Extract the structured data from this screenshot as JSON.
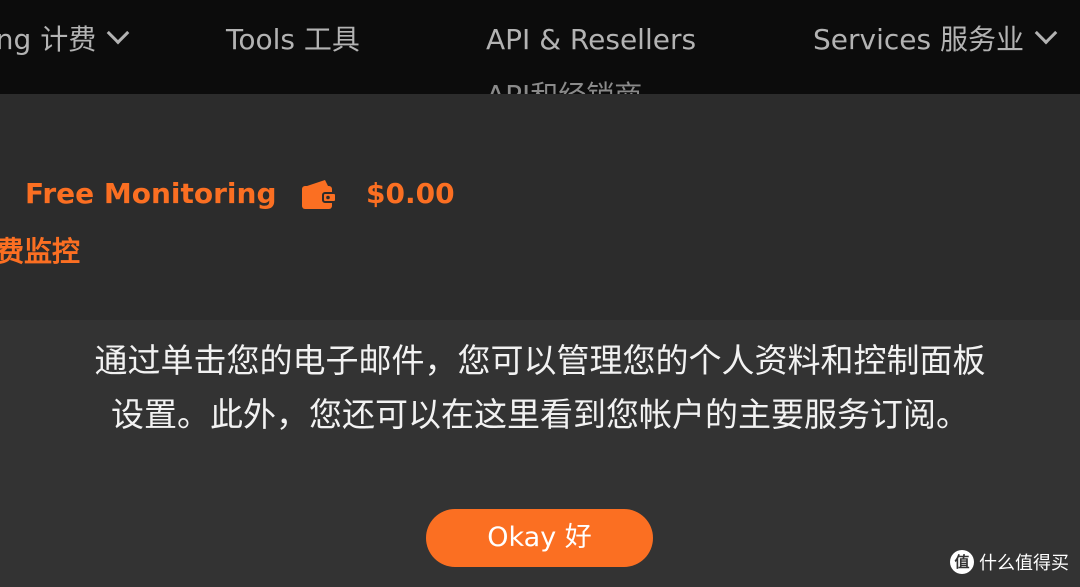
{
  "nav": {
    "billing_label": "ing  计费",
    "tools_label": "Tools  工具",
    "api_label": "API & Resellers",
    "api_label_cn": "API和经销商",
    "services_label": "Services  服务业"
  },
  "account": {
    "plan_name": "Free Monitoring",
    "plan_name_cn": "费监控",
    "wallet_icon": "wallet-icon",
    "balance": "$0.00",
    "accent_color": "#fb6f22"
  },
  "tooltip": {
    "message_line1": "通过单击您的电子邮件，您可以管理您的个人资料和控制面板",
    "message_line2": "设置。此外，您还可以在这里看到您帐户的主要服务订阅。",
    "okay_label": "Okay  好"
  },
  "watermark": {
    "badge": "值",
    "text": "什么值得买"
  }
}
